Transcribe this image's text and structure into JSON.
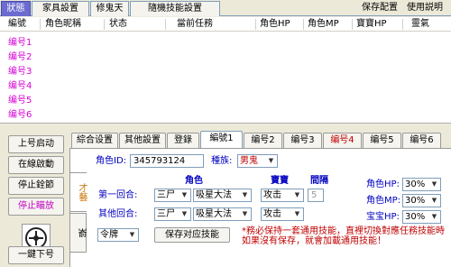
{
  "top_tabs": [
    {
      "label": "狀態",
      "active": true
    },
    {
      "label": "家具設置",
      "active": false
    },
    {
      "label": "修鬼天",
      "active": false
    },
    {
      "label": "隨機技能設置",
      "active": false
    }
  ],
  "top_links": {
    "save_config": "保存配置",
    "help": "使用説明"
  },
  "table": {
    "columns": [
      "編號",
      "角色昵稱",
      "状态",
      "當前任務",
      "角色HP",
      "角色MP",
      "寶寶HP",
      "靈氣"
    ],
    "rows": [
      "编号1",
      "编号2",
      "编号3",
      "编号4",
      "编号5",
      "编号6"
    ]
  },
  "sidebar": {
    "buttons": [
      {
        "label": "上号启动",
        "disabled": false
      },
      {
        "label": "在線啟動",
        "disabled": false
      },
      {
        "label": "停止銓節",
        "disabled": false
      },
      {
        "label": "停止瞄放",
        "disabled": true
      }
    ],
    "bottom_button": "一鍵下号"
  },
  "sub_tabs": [
    {
      "label": "綜合设置",
      "active": false,
      "red": false
    },
    {
      "label": "其他設置",
      "active": false,
      "red": false
    },
    {
      "label": "登錄",
      "active": false,
      "red": false
    },
    {
      "label": "編號1",
      "active": true,
      "red": false
    },
    {
      "label": "编号2",
      "active": false,
      "red": false
    },
    {
      "label": "编号3",
      "active": false,
      "red": false
    },
    {
      "label": "编号4",
      "active": false,
      "red": true
    },
    {
      "label": "编号5",
      "active": false,
      "red": false
    },
    {
      "label": "编号6",
      "active": false,
      "red": false
    }
  ],
  "panel": {
    "role_id_label": "角色ID:",
    "role_id_value": "345793124",
    "race_label": "種族:",
    "race_value": "男鬼",
    "vertical_tabs": [
      {
        "label": "才藝",
        "active": true
      },
      {
        "label": "嵛",
        "active": false
      }
    ],
    "headers": {
      "role": "角色",
      "pet": "寶寶",
      "interval": "間隔"
    },
    "round1_label": "第一回合:",
    "round2_label": "其他回合:",
    "round1": {
      "role_target": "三尸",
      "role_skill": "吸星大法",
      "pet_action": "攻击",
      "interval": "5"
    },
    "round2": {
      "role_target": "三尸",
      "role_skill": "吸星大法",
      "pet_action": "攻击"
    },
    "token_select": "令牌",
    "save_skill_button": "保存对应技能",
    "right_labels": {
      "hp": "角色HP:",
      "mp": "角色MP:",
      "pet_hp": "宝宝HP:"
    },
    "right_values": {
      "hp": "30%",
      "mp": "30%",
      "pet_hp": "30%"
    },
    "warning": "*務必保持一套通用技能，直裡切換對應任務技能時如果沒有保存，就會加載通用技能！"
  },
  "colors": {
    "active_top_tab": "#6b6bd0",
    "row_label": "#d400d4",
    "warning": "#c00000"
  }
}
